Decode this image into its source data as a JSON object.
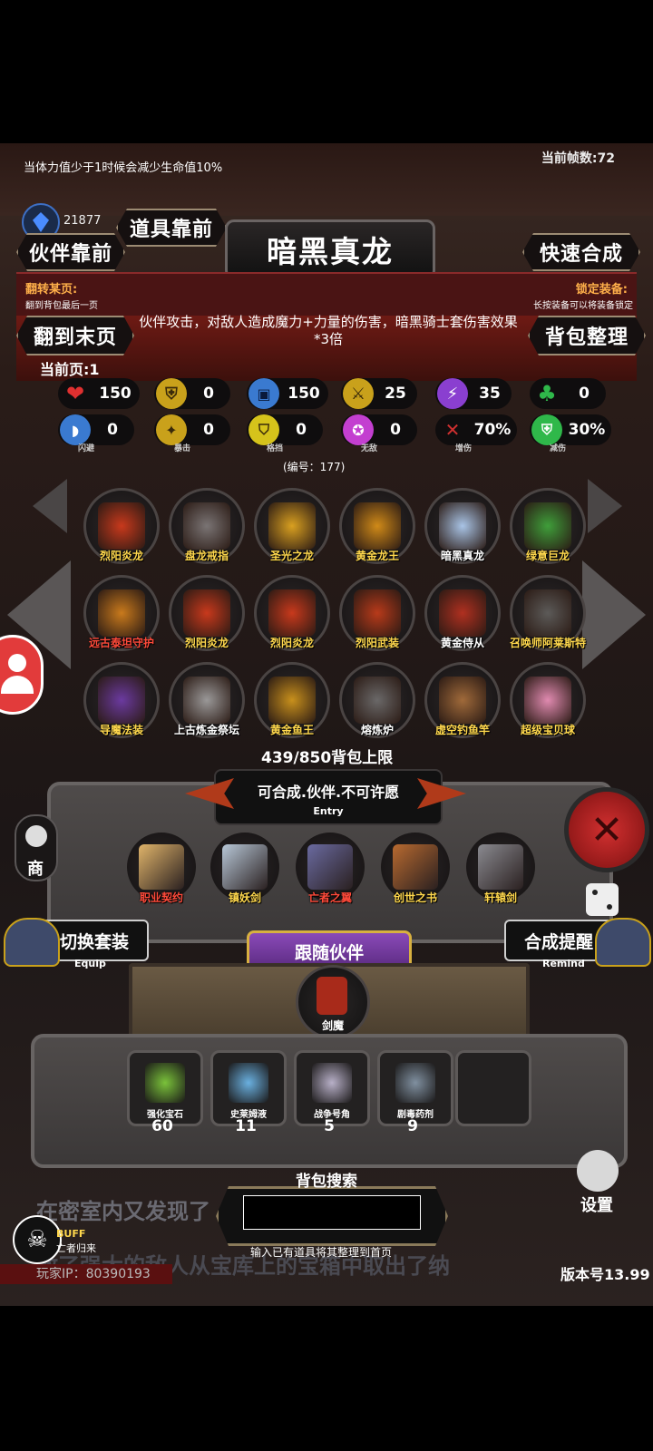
{
  "hud": {
    "hint": "当体力值少于1时候会减少生命值10%",
    "fps_label": "当前帧数:72",
    "gem_count": "21877"
  },
  "top_buttons": {
    "items_front": "道具靠前",
    "partner_front": "伙伴靠前",
    "quick_merge": "快速合成",
    "to_last_page": "翻到末页",
    "bag_sort": "背包整理"
  },
  "flip_page": {
    "title": "翻转某页:",
    "desc": "翻到背包最后一页"
  },
  "lock_equip": {
    "title": "锁定装备:",
    "desc": "长按装备可以将装备锁定"
  },
  "item": {
    "name": "暗黑真龙",
    "description": "伙伴攻击，对敌人造成魔力+力量的伤害，暗黑骑士套伤害效果*3倍",
    "id_label": "(编号：177)"
  },
  "current_page": "当前页:1",
  "stats_row1": [
    {
      "icon": "heart-icon",
      "value": "150",
      "color": "#e03030"
    },
    {
      "icon": "armor-icon",
      "value": "0",
      "color": "#c9a11b"
    },
    {
      "icon": "helmet-icon",
      "value": "150",
      "color": "#3a7ad0"
    },
    {
      "icon": "sword-icon",
      "value": "25",
      "color": "#c9a11b"
    },
    {
      "icon": "lightning-icon",
      "value": "35",
      "color": "#8a3fd0"
    },
    {
      "icon": "clover-icon",
      "value": "0",
      "color": "#2fb84a"
    }
  ],
  "stats_row2": [
    {
      "icon": "dodge-icon",
      "value": "0",
      "sub": "闪避",
      "color": "#3a7ad0"
    },
    {
      "icon": "crit-icon",
      "value": "0",
      "sub": "暴击",
      "color": "#c9a11b"
    },
    {
      "icon": "block-icon",
      "value": "0",
      "sub": "格挡",
      "color": "#d6c31b"
    },
    {
      "icon": "invincible-icon",
      "value": "0",
      "sub": "无敌",
      "color": "#c33fd0"
    },
    {
      "icon": "damage-up-icon",
      "value": "70%",
      "sub": "增伤",
      "color": "#d03030"
    },
    {
      "icon": "damage-reduce-icon",
      "value": "30%",
      "sub": "减伤",
      "color": "#2fb84a"
    }
  ],
  "inventory": [
    {
      "name": "烈阳炎龙",
      "label_color": "yellow",
      "art": "#c8391c"
    },
    {
      "name": "盘龙戒指",
      "label_color": "yellow",
      "art": "#7a7474"
    },
    {
      "name": "圣光之龙",
      "label_color": "yellow",
      "art": "#d9a020"
    },
    {
      "name": "黄金龙王",
      "label_color": "yellow",
      "art": "#d08a18"
    },
    {
      "name": "暗黑真龙",
      "label_color": "white",
      "art": "#a9c4e6"
    },
    {
      "name": "绿意巨龙",
      "label_color": "yellow",
      "art": "#3f9e3a"
    },
    {
      "name": "远古泰坦守护",
      "label_color": "red",
      "art": "#c97a1c"
    },
    {
      "name": "烈阳炎龙",
      "label_color": "yellow",
      "art": "#c8391c"
    },
    {
      "name": "烈阳炎龙",
      "label_color": "yellow",
      "art": "#c8391c"
    },
    {
      "name": "烈阳武装",
      "label_color": "yellow",
      "art": "#b83a1a"
    },
    {
      "name": "黄金侍从",
      "label_color": "white",
      "art": "#b03020"
    },
    {
      "name": "召唤师阿莱斯特",
      "label_color": "yellow",
      "art": "#5c5a58"
    },
    {
      "name": "导魔法装",
      "label_color": "yellow",
      "art": "#6b3aa0"
    },
    {
      "name": "上古炼金祭坛",
      "label_color": "white",
      "art": "#9a9898"
    },
    {
      "name": "黄金鱼王",
      "label_color": "yellow",
      "art": "#c8901c"
    },
    {
      "name": "熔炼炉",
      "label_color": "white",
      "art": "#6a6868"
    },
    {
      "name": "虚空钓鱼竿",
      "label_color": "yellow",
      "art": "#a06a3a"
    },
    {
      "name": "超级宝贝球",
      "label_color": "yellow",
      "art": "#e08ab0"
    }
  ],
  "bag_capacity": "439/850背包上限",
  "entry": {
    "title": "可合成.伙伴.不可许愿",
    "sub": "Entry"
  },
  "craft_items": [
    {
      "name": "职业契约",
      "label_color": "red",
      "art": "#e0b46a"
    },
    {
      "name": "镇妖剑",
      "label_color": "yellow",
      "art": "#b8c8d8"
    },
    {
      "name": "亡者之翼",
      "label_color": "red",
      "art": "#6a6aa0"
    },
    {
      "name": "创世之书",
      "label_color": "yellow",
      "art": "#b86a30"
    },
    {
      "name": "轩辕剑",
      "label_color": "yellow",
      "art": "#8a8a90"
    }
  ],
  "equip_switch": {
    "label": "切换套装",
    "sub": "Equip"
  },
  "merge_remind": {
    "label": "合成提醒",
    "sub": "Remind"
  },
  "follow_partner": {
    "title": "跟随伙伴",
    "name": "剑魔"
  },
  "consumables": [
    {
      "name": "强化宝石",
      "count": "60",
      "art": "#7ac23a"
    },
    {
      "name": "史莱姆液",
      "count": "11",
      "art": "#6ab0e0"
    },
    {
      "name": "战争号角",
      "count": "5",
      "art": "#b8b0c8"
    },
    {
      "name": "剧毒药剂",
      "count": "9",
      "art": "#8090a0"
    }
  ],
  "side": {
    "shop": "商",
    "settings": "设置"
  },
  "bag_search": {
    "label": "背包搜索",
    "hint": "输入已有道具将其整理到首页",
    "placeholder": ""
  },
  "story_text": {
    "line1": "在密室内又发现了",
    "line2": "敢了强大的敌人从宝库上的宝箱中取出了纳"
  },
  "buff": {
    "label": "BUFF",
    "desc": "亡者归来"
  },
  "player_ip": "玩家IP：80390193",
  "version": "版本号13.99"
}
